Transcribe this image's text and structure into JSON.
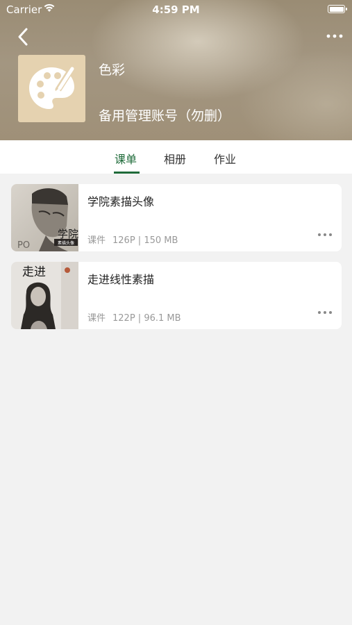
{
  "status_bar": {
    "carrier": "Carrier",
    "time": "4:59 PM"
  },
  "header": {
    "title": "色彩",
    "subtitle": "备用管理账号（勿删）",
    "avatar_icon": "palette-icon",
    "colors": {
      "background": "#9f9078",
      "avatar_bg": "#e5d2b0"
    }
  },
  "tabs": [
    {
      "label": "课单",
      "active": true
    },
    {
      "label": "相册",
      "active": false
    },
    {
      "label": "作业",
      "active": false
    }
  ],
  "accent_color": "#1f6b3a",
  "courses": [
    {
      "title": "学院素描头像",
      "type": "课件",
      "detail": "126P | 150 MB",
      "cover_text": "学院",
      "cover_small": "素描头像",
      "cover_bottom": "PO"
    },
    {
      "title": "走进线性素描",
      "type": "课件",
      "detail": "122P | 96.1 MB",
      "cover_text": "走进"
    }
  ]
}
